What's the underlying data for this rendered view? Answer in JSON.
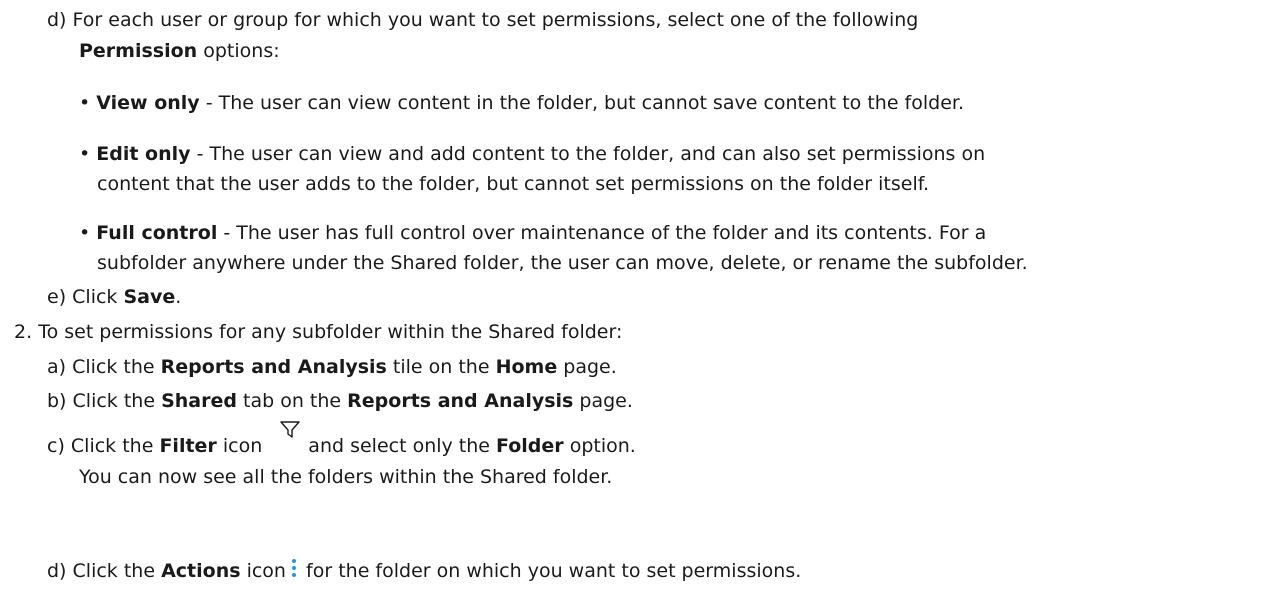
{
  "step_1d": {
    "marker": "d)",
    "text_a": "For each user or group for which you want to set permissions, select one of the following",
    "bold": "Permission",
    "text_b": "options:"
  },
  "options": [
    {
      "bullet": "•",
      "bold": "View only",
      "lines": [
        "- The user can view content in the folder, but cannot save content to the folder."
      ]
    },
    {
      "bullet": "•",
      "bold": "Edit only",
      "lines": [
        "- The user can view and add content to the folder, and can also set permissions on",
        "content that the user adds to the folder, but cannot set permissions on the folder itself."
      ]
    },
    {
      "bullet": "•",
      "bold": "Full control",
      "lines": [
        "- The user has full control over maintenance of the folder and its contents. For a",
        "subfolder anywhere under the Shared folder, the user can move, delete, or rename the subfolder."
      ]
    }
  ],
  "step_1e": {
    "marker": "e)",
    "text": "Click",
    "bold": "Save",
    "end": "."
  },
  "step_2": {
    "marker": "2.",
    "text": "To set permissions for any subfolder within the Shared folder:"
  },
  "step_2a": {
    "marker": "a)",
    "t1": "Click the",
    "b1": "Reports and Analysis",
    "t2": "tile on the",
    "b2": "Home",
    "t3": "page."
  },
  "step_2b": {
    "marker": "b)",
    "t1": "Click the",
    "b1": "Shared",
    "t2": "tab on the",
    "b2": "Reports and Analysis",
    "t3": "page."
  },
  "step_2c": {
    "marker": "c)",
    "t1": "Click the",
    "b1": "Filter",
    "t2": "icon",
    "icon": "filter-icon",
    "t3": "and select only the",
    "b2": "Folder",
    "t4": "option.",
    "result": "You can now see all the folders within the Shared folder."
  },
  "step_2d": {
    "marker": "d)",
    "t1": "Click the",
    "b1": "Actions",
    "t2": "icon",
    "icon": "actions-icon",
    "t3": "for the folder on which you want to set permissions."
  },
  "colors": {
    "text": "#1a1a1a",
    "actions_icon": "#1e9bd7"
  }
}
